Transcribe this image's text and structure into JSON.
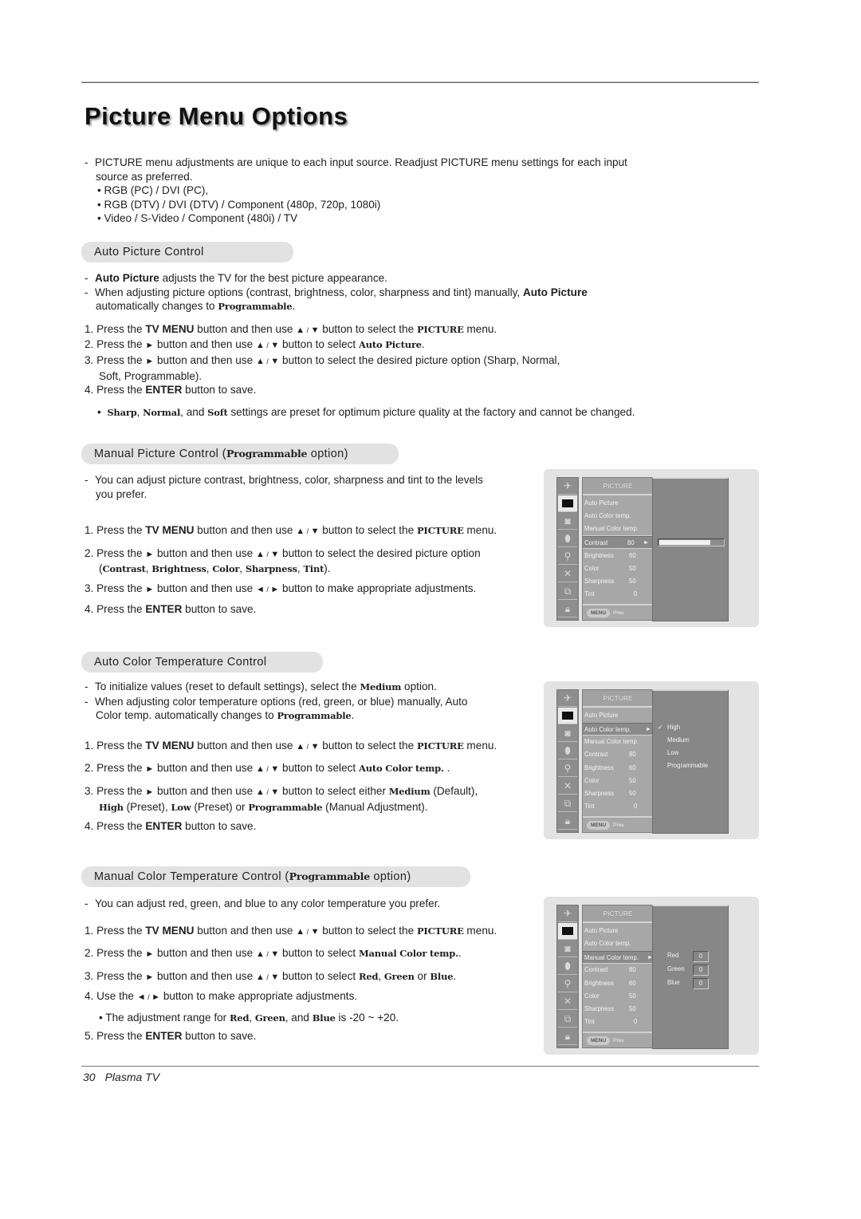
{
  "page": {
    "title": "Picture Menu Options",
    "footer_number": "30",
    "footer_text": "Plasma TV"
  },
  "intro": {
    "text": "PICTURE menu adjustments are unique to each input source. Readjust PICTURE menu settings for each input",
    "text2": "source as preferred.",
    "sources": [
      "RGB (PC) / DVI (PC),",
      "RGB (DTV) / DVI (DTV) / Component (480p, 720p, 1080i)",
      "Video / S-Video / Component (480i) / TV"
    ]
  },
  "auto_picture": {
    "heading": "Auto Picture Control",
    "b1_bold": "Auto Picture",
    "b1_rest": " adjusts the TV for the best picture appearance.",
    "b2_a": "When adjusting picture options (contrast, brightness, color, sharpness and tint) manually, ",
    "b2_bold": "Auto Picture",
    "b2_b": "automatically changes to ",
    "b2_serif": "Programmable",
    "step1": {
      "a": "1. Press the ",
      "b": "TV MENU",
      "c": " button and then use ",
      "d": " button to select the ",
      "e": "PICTURE",
      "f": " menu."
    },
    "step2": {
      "a": "2. Press the ",
      "c": " button and then use ",
      "d": " button to select ",
      "e": "Auto Picture",
      "f": "."
    },
    "step3": {
      "a": "3. Press the ",
      "c": " button and then use ",
      "d": " button to select the desired picture option (Sharp, Normal,",
      "e": "Soft, Programmable)."
    },
    "step4": {
      "a": "4. Press the ",
      "b": "ENTER",
      "c": " button to save."
    },
    "note": {
      "s1": "Sharp",
      "s2": "Normal",
      "s3": "Soft",
      "sep1": ", ",
      "sep2": ", and ",
      "rest": " settings are preset for optimum picture quality at the factory and cannot be changed."
    }
  },
  "manual_picture": {
    "heading_a": "Manual Picture Control (",
    "heading_serif": "Programmable",
    "heading_b": " option)",
    "b1": "You can adjust picture contrast, brightness, color, sharpness and tint to the levels",
    "b1b": "you prefer.",
    "step1": {
      "a": "1. Press the ",
      "b": "TV MENU",
      "c": " button and then use ",
      "d": " button to select the ",
      "e": "PICTURE",
      "f": " menu."
    },
    "step2": {
      "a": "2. Press the ",
      "c": " button and then use ",
      "d": " button to select the desired picture option",
      "opts": [
        "Contrast",
        "Brightness",
        "Color",
        "Sharpness",
        "Tint"
      ]
    },
    "step3": {
      "a": "3. Press the ",
      "c": " button and then use ",
      "d": " button to make appropriate adjustments."
    },
    "step4": {
      "a": "4. Press the ",
      "b": "ENTER",
      "c": " button to save."
    }
  },
  "auto_color": {
    "heading": "Auto Color Temperature Control",
    "b1_a": "To initialize values (reset to default settings), select the ",
    "b1_serif": "Medium",
    "b1_b": " option.",
    "b2_a": "When adjusting color temperature options (red, green, or blue) manually, Auto",
    "b2_b": "Color temp. automatically changes to ",
    "b2_serif": "Programmable",
    "step1": {
      "a": "1. Press the ",
      "b": "TV MENU",
      "c": " button and then use ",
      "d": " button to select the ",
      "e": "PICTURE",
      "f": " menu."
    },
    "step2": {
      "a": "2. Press the ",
      "c": " button and then use ",
      "d": " button to select ",
      "e": "Auto Color temp.",
      "f": " ."
    },
    "step3": {
      "a": "3. Press the ",
      "c": " button and then use ",
      "d": " button to select either ",
      "medium": "Medium",
      "default": " (Default),",
      "high": "High",
      "preset1": " (Preset), ",
      "low": "Low",
      "preset2": " (Preset) or ",
      "prog": "Programmable",
      "manual": " (Manual Adjustment)."
    },
    "step4": {
      "a": "4. Press the ",
      "b": "ENTER",
      "c": " button to save."
    }
  },
  "manual_color": {
    "heading_a": "Manual Color Temperature Control (",
    "heading_serif": "Programmable",
    "heading_b": " option)",
    "b1": "You can adjust red, green, and blue to any color temperature you prefer.",
    "step1": {
      "a": "1. Press the ",
      "b": "TV MENU",
      "c": " button and then use ",
      "d": " button to select the ",
      "e": "PICTURE",
      "f": " menu."
    },
    "step2": {
      "a": "2. Press the ",
      "c": " button and then use ",
      "d": " button to select ",
      "e": "Manual Color temp.",
      "f": "."
    },
    "step3": {
      "a": "3. Press the ",
      "c": " button and then use ",
      "d": " button to select ",
      "red": "Red",
      "comma": ", ",
      "green": "Green",
      "or": " or ",
      "blue": "Blue",
      "f": "."
    },
    "step4": {
      "a": "4. Use the ",
      "c": " button to make appropriate adjustments."
    },
    "note": {
      "a": "The adjustment range for ",
      "red": "Red",
      "comma": ", ",
      "green": "Green",
      "and": ", and ",
      "blue": "Blue",
      "b": " is -20 ~ +20."
    },
    "step5": {
      "a": "5. Press the ",
      "b": "ENTER",
      "c": " button to save."
    }
  },
  "symbols": {
    "up": "▲",
    "down": "▼",
    "right": "►",
    "left": "◄",
    "slash": " / ",
    "bullet": "•",
    "dash": "-",
    "check": "✓"
  },
  "osd": {
    "icons": [
      "satellite-dish-icon",
      "picture-icon",
      "speaker-icon",
      "timer-icon",
      "key-tag-icon",
      "cross-icon",
      "pip-icon",
      "lock-icon"
    ],
    "menu_title": "PICTURE",
    "items": [
      {
        "label": "Auto Picture",
        "value": ""
      },
      {
        "label": "Auto Color temp.",
        "value": ""
      },
      {
        "label": "Manual Color temp.",
        "value": ""
      },
      {
        "label": "Contrast",
        "value": "80"
      },
      {
        "label": "Brightness",
        "value": "60"
      },
      {
        "label": "Color",
        "value": "50"
      },
      {
        "label": "Sharpness",
        "value": "50"
      },
      {
        "label": "Tint",
        "value": "0"
      }
    ],
    "menu_button": "MENU",
    "prev_label": "Prev.",
    "contrast_level_percent": 80,
    "color_temp_options": [
      "High",
      "Medium",
      "Low",
      "Programmable"
    ],
    "color_temp_selected": "High",
    "rgb": [
      {
        "label": "Red",
        "value": "0"
      },
      {
        "label": "Green",
        "value": "0"
      },
      {
        "label": "Blue",
        "value": "0"
      }
    ]
  }
}
